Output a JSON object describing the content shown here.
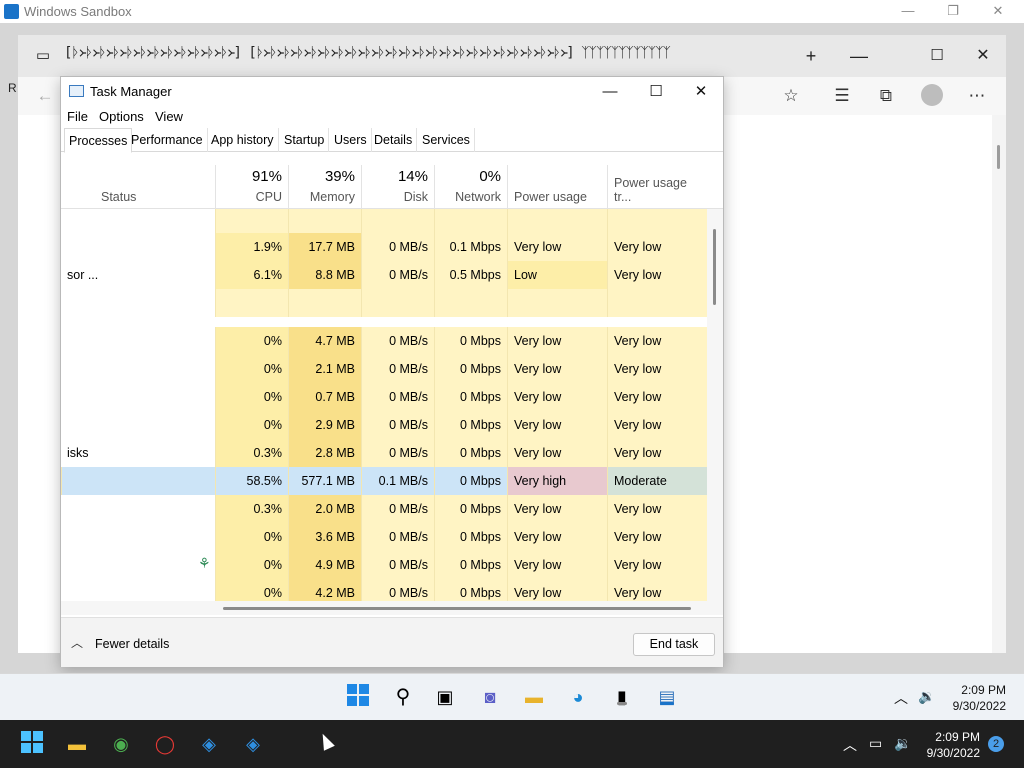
{
  "sandbox": {
    "title": "Windows Sandbox",
    "left_peek": "R"
  },
  "edge": {
    "tab_glyphs": "[ᚦ᚛ᚦ᚛ᚦ᚛ᚦ᚛ᚦ᚛ᚦ᚛ᚦ᚛ᚦ᚛ᚦ᚛ᚦ᚛ᚦ᚛ᚦ᚛]  [ᚦ᚛ᚦ᚛ᚦ᚛ᚦ᚛ᚦ᚛ᚦ᚛ᚦ᚛ᚦ᚛ᚦ᚛ᚦ᚛ᚦ᚛ᚦ᚛ᚦ᚛ᚦ᚛ᚦ᚛ᚦ᚛ᚦ᚛ᚦ᚛ᚦ᚛ᚦ᚛ᚦ᚛ᚦ᚛ᚦ᚛] ᛉᛉᛉᛉᛉᛉᛉᛉᛉᛉᛉᛉ",
    "new_tab": "+",
    "minimize": "—",
    "maximize": "☐",
    "close": "✕"
  },
  "task_manager": {
    "title": "Task Manager",
    "menu": [
      "File",
      "Options",
      "View"
    ],
    "tabs": [
      "Processes",
      "Performance",
      "App history",
      "Startup",
      "Users",
      "Details",
      "Services"
    ],
    "header": {
      "status": "Status",
      "cpu_pct": "91%",
      "cpu": "CPU",
      "memory_pct": "39%",
      "memory": "Memory",
      "disk_pct": "14%",
      "disk": "Disk",
      "network_pct": "0%",
      "network": "Network",
      "power": "Power usage",
      "power_trend": "Power usage tr..."
    },
    "rows": [
      {
        "status": "",
        "cpu": "",
        "memory": "",
        "disk": "",
        "network": "",
        "power": "",
        "trend": "",
        "kind": "blank"
      },
      {
        "status": "",
        "cpu": "1.9%",
        "memory": "17.7 MB",
        "disk": "0 MB/s",
        "network": "0.1 Mbps",
        "power": "Very low",
        "trend": "Very low",
        "kind": "normal"
      },
      {
        "status": "sor ...",
        "cpu": "6.1%",
        "memory": "8.8 MB",
        "disk": "0 MB/s",
        "network": "0.5 Mbps",
        "power": "Low",
        "trend": "Very low",
        "kind": "normal"
      },
      {
        "status": "",
        "cpu": "",
        "memory": "",
        "disk": "",
        "network": "",
        "power": "",
        "trend": "",
        "kind": "group"
      },
      {
        "status": "",
        "cpu": "0%",
        "memory": "4.7 MB",
        "disk": "0 MB/s",
        "network": "0 Mbps",
        "power": "Very low",
        "trend": "Very low",
        "kind": "normal"
      },
      {
        "status": "",
        "cpu": "0%",
        "memory": "2.1 MB",
        "disk": "0 MB/s",
        "network": "0 Mbps",
        "power": "Very low",
        "trend": "Very low",
        "kind": "normal"
      },
      {
        "status": "",
        "cpu": "0%",
        "memory": "0.7 MB",
        "disk": "0 MB/s",
        "network": "0 Mbps",
        "power": "Very low",
        "trend": "Very low",
        "kind": "normal"
      },
      {
        "status": "",
        "cpu": "0%",
        "memory": "2.9 MB",
        "disk": "0 MB/s",
        "network": "0 Mbps",
        "power": "Very low",
        "trend": "Very low",
        "kind": "normal"
      },
      {
        "status": "isks",
        "cpu": "0.3%",
        "memory": "2.8 MB",
        "disk": "0 MB/s",
        "network": "0 Mbps",
        "power": "Very low",
        "trend": "Very low",
        "kind": "normal"
      },
      {
        "status": "",
        "cpu": "58.5%",
        "memory": "577.1 MB",
        "disk": "0.1 MB/s",
        "network": "0 Mbps",
        "power": "Very high",
        "trend": "Moderate",
        "kind": "selected"
      },
      {
        "status": "",
        "cpu": "0.3%",
        "memory": "2.0 MB",
        "disk": "0 MB/s",
        "network": "0 Mbps",
        "power": "Very low",
        "trend": "Very low",
        "kind": "normal"
      },
      {
        "status": "",
        "cpu": "0%",
        "memory": "3.6 MB",
        "disk": "0 MB/s",
        "network": "0 Mbps",
        "power": "Very low",
        "trend": "Very low",
        "kind": "normal"
      },
      {
        "status": "",
        "cpu": "0%",
        "memory": "4.9 MB",
        "disk": "0 MB/s",
        "network": "0 Mbps",
        "power": "Very low",
        "trend": "Very low",
        "kind": "leaf"
      },
      {
        "status": "",
        "cpu": "0%",
        "memory": "4.2 MB",
        "disk": "0 MB/s",
        "network": "0 Mbps",
        "power": "Very low",
        "trend": "Very low",
        "kind": "normal"
      }
    ],
    "footer": {
      "fewer_details": "Fewer details",
      "end_task": "End task"
    },
    "colors": {
      "cell_light": "#fff4c4",
      "cell_mid": "#fdeea8",
      "cell_memory": "#f9e08a",
      "selected": "#cce4f7",
      "very_high": "#e8c9cf",
      "moderate": "#d4e2d8"
    }
  },
  "inner_taskbar": {
    "time": "2:09 PM",
    "date": "9/30/2022"
  },
  "host_taskbar": {
    "time": "2:09 PM",
    "date": "9/30/2022",
    "notification_count": "2"
  }
}
